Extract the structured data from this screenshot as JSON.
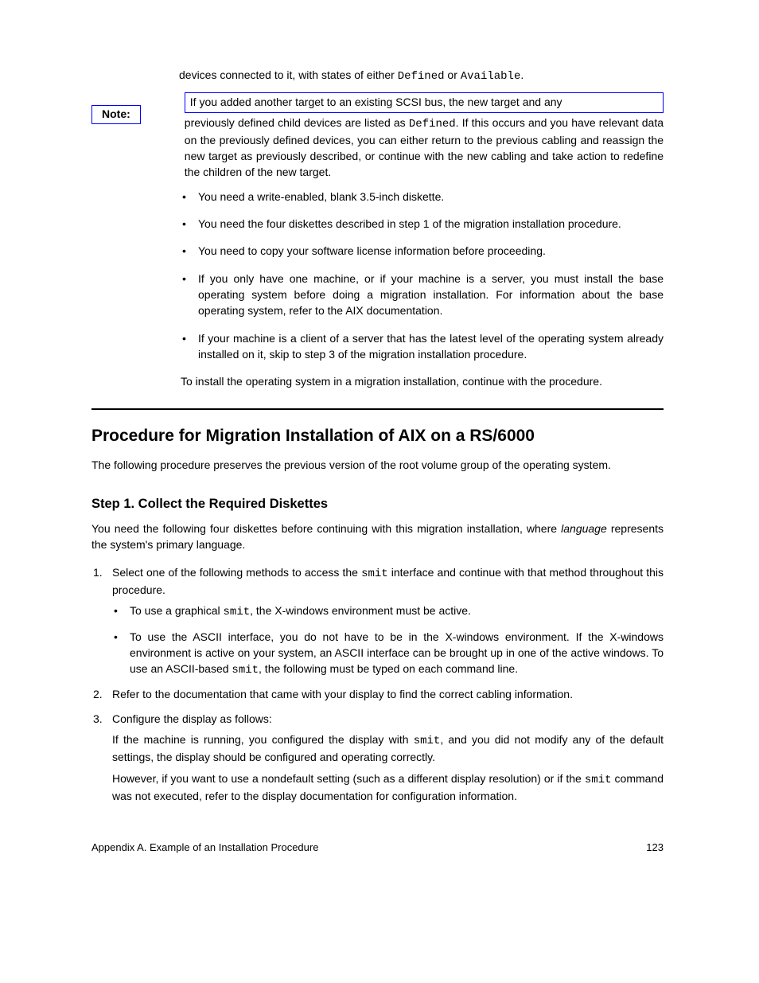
{
  "para1_a": "devices connected to it, with states of either ",
  "para1_b": " or ",
  "para1_c": ".",
  "code_defined": "Defined",
  "code_available": "Available",
  "note_label": "Note:",
  "note_line1": "If you added another target to an existing SCSI bus, the new target and any",
  "note_rest_a": "previously defined child devices are listed as ",
  "note_rest_b": ". If this occurs and you have relevant data on the previously defined devices, you can either return to the previous cabling and reassign the new target as previously described, or continue with the new cabling and take action to redefine the children of the new target.",
  "bullets_intro": "",
  "bullets": [
    "You need a write-enabled, blank 3.5-inch diskette.",
    "You need the four diskettes described in step 1 of the migration installation procedure.",
    "You need to copy your software license information before proceeding.",
    "If you only have one machine, or if your machine is a server, you must install the base operating system before doing a migration installation. For information about the base operating system, refer to the AIX documentation.",
    "If your machine is a client of a server that has the latest level of the operating system already installed on it, skip to step 3 of the migration installation procedure."
  ],
  "after_list": "To install the operating system in a migration installation, continue with the procedure.",
  "section_heading": "Procedure for Migration Installation of AIX on a RS/6000",
  "intro_para": "The following procedure preserves the previous version of the root volume group of the operating system.",
  "subsection_heading": "Step 1. Collect the Required Diskettes",
  "step1_intro_a": "You need the following four diskettes before continuing with this migration installation, where ",
  "step1_intro_b": " represents the system's primary language.",
  "step1_intro_em": "language",
  "steps": [
    {
      "main_a": "Select one of the following methods to access the ",
      "main_b": " interface and continue with that method throughout this procedure.",
      "mono": "smit",
      "sub_bullets": [
        {
          "a": "To use a graphical ",
          "b": ", the X-windows environment must be active.",
          "mono": "smit"
        },
        {
          "a": "To use the ASCII interface, you do not have to be in the X-windows environment. If the X-windows environment is active on your system, an ASCII interface can be brought up in one of the active windows. To use an ASCII-based ",
          "b": ", the following must be typed on each command line.",
          "mono": "smit"
        }
      ]
    },
    {
      "main_a": "Refer to the documentation that came with your display to find the correct cabling information.",
      "mono": "",
      "main_b": "",
      "sub_bullets": []
    },
    {
      "main_a": "Configure the display as follows:",
      "mono": "",
      "main_b": "",
      "sub_a": "If the machine is running, you configured the display with ",
      "sub_mono": "smit",
      "sub_b": ", and you did not modify any of the default settings, the display should be configured and operating correctly.",
      "sub2_a": "However, if you want to use a nondefault setting (such as a different display resolution) or if the ",
      "sub2_mono": "smit",
      "sub2_b": " command was not executed, refer to the display documentation for configuration information."
    }
  ],
  "footer_left": "Appendix A. Example of an Installation Procedure",
  "footer_right": "123"
}
